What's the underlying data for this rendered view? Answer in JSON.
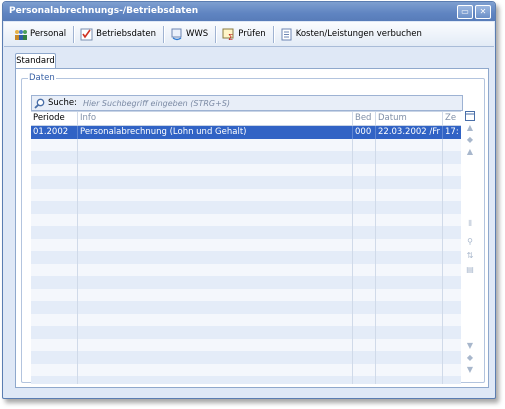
{
  "window": {
    "title": "Personalabrechnungs-/Betriebsdaten"
  },
  "titlebar_buttons": [
    {
      "name": "restore-button",
      "icon": "restore-icon",
      "glyph": "▭"
    },
    {
      "name": "close-button",
      "icon": "close-icon",
      "glyph": "✕"
    }
  ],
  "toolbar": {
    "items": [
      {
        "label": "Personal",
        "icon": "people-icon"
      },
      {
        "label": "Betriebsdaten",
        "icon": "checklist-icon"
      },
      {
        "label": "WWS",
        "icon": "refresh-icon"
      },
      {
        "label": "Prüfen",
        "icon": "sum-check-icon"
      },
      {
        "label": "Kosten/Leistungen verbuchen",
        "icon": "document-icon"
      }
    ]
  },
  "tab": {
    "label": "Standard"
  },
  "group": {
    "label": "Daten"
  },
  "search": {
    "label": "Suche:",
    "placeholder": "Hier Suchbegriff eingeben (STRG+S)"
  },
  "grid": {
    "columns": [
      "Periode",
      "Info",
      "Bed",
      "Datum",
      "Ze"
    ],
    "rows": [
      {
        "periode": "01.2002",
        "info": "Personalabrechnung (Lohn und Gehalt)",
        "bed": "000",
        "datum": "22.03.2002 /Fr",
        "zeit": "17:"
      }
    ],
    "empty_rows": 20
  },
  "colors": {
    "accent": "#5f84c1",
    "selection": "#3163c5",
    "row_alt": "#e4ecf8"
  }
}
